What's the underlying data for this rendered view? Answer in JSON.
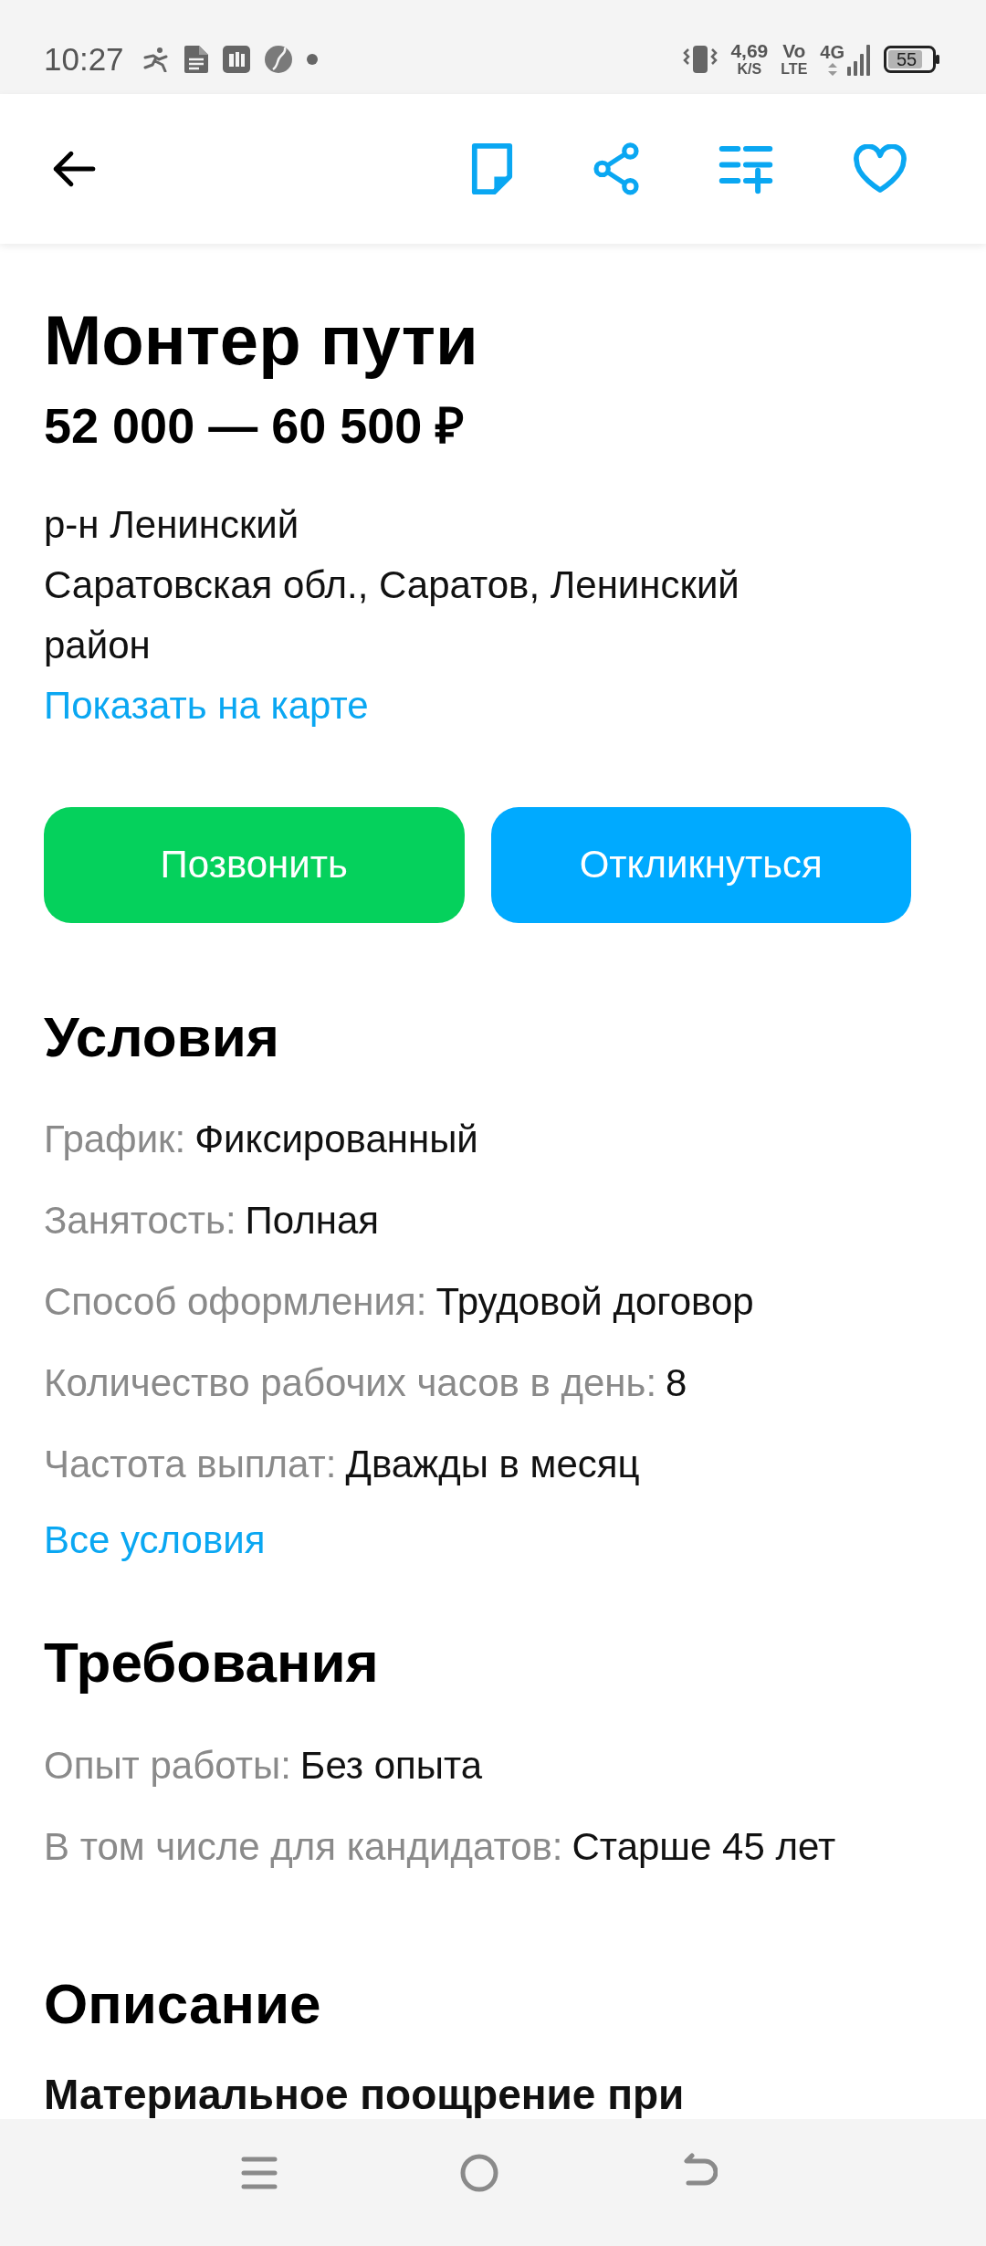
{
  "status_bar": {
    "time": "10:27",
    "speed": "4,69",
    "speed_unit": "K/S",
    "volte_top": "Vo",
    "volte_bottom": "LTE",
    "network": "4G",
    "battery": "55"
  },
  "toolbar": {
    "favorited": false
  },
  "vacancy": {
    "title": "Монтер пути",
    "salary": "52 000 — 60 500 ₽",
    "district": "р-н Ленинский",
    "address": "Саратовская обл., Саратов, Ленинский район",
    "map_link": "Показать на карте"
  },
  "actions": [
    {
      "kind": "call",
      "label": "Позвонить"
    },
    {
      "kind": "respond",
      "label": "Откликнуться"
    }
  ],
  "sections": [
    {
      "title": "Условия",
      "rows": [
        {
          "label": "График:",
          "value": "Фиксированный"
        },
        {
          "label": "Занятость:",
          "value": "Полная"
        },
        {
          "label": "Способ оформления:",
          "value": "Трудовой договор"
        },
        {
          "label": "Количество рабочих часов в день:",
          "value": "8"
        },
        {
          "label": "Частота выплат:",
          "value": "Дважды в месяц"
        }
      ],
      "link": "Все условия"
    },
    {
      "title": "Требования",
      "rows": [
        {
          "label": "Опыт работы:",
          "value": "Без опыта"
        },
        {
          "label": "В том числе для кандидатов:",
          "value": "Старше 45 лет"
        }
      ]
    },
    {
      "title": "Описание",
      "text": "Материальное поощрение при"
    }
  ]
}
